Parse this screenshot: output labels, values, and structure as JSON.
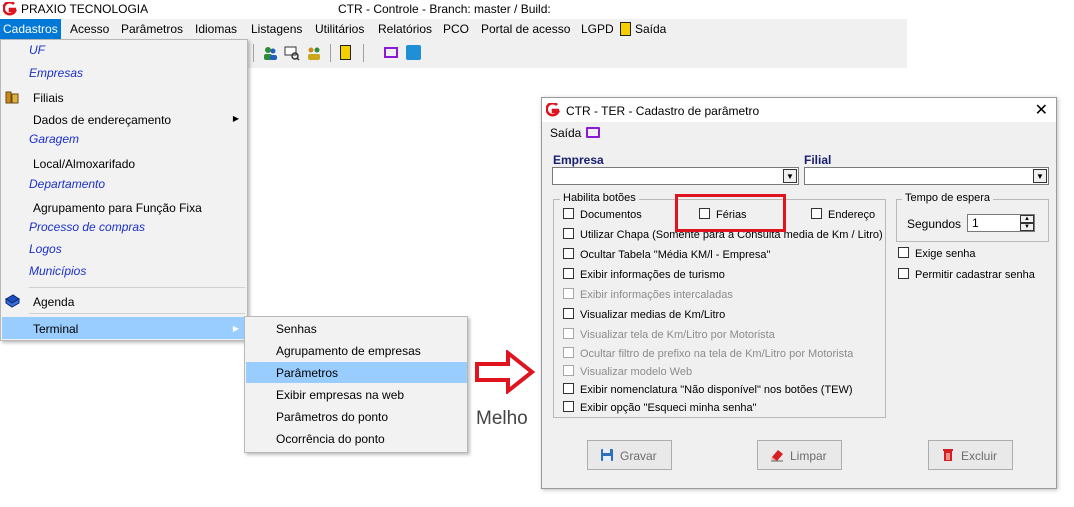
{
  "app": {
    "name": "PRAXIO TECNOLOGIA",
    "window_title": "CTR - Controle - Branch: master / Build:"
  },
  "menubar": {
    "items": [
      "Cadastros",
      "Acesso",
      "Parâmetros",
      "Idiomas",
      "Listagens",
      "Utilitários",
      "Relatórios",
      "PCO",
      "Portal de acesso",
      "LGPD"
    ],
    "saida": "Saída"
  },
  "cadastros_menu": {
    "items": [
      "UF",
      "Empresas",
      "Filiais",
      "Dados de endereçamento",
      "Garagem",
      "Local/Almoxarifado",
      "Departamento",
      "Agrupamento para Função Fixa",
      "Processo de compras",
      "Logos",
      "Municípios",
      "Agenda",
      "Terminal"
    ]
  },
  "terminal_submenu": {
    "items": [
      "Senhas",
      "Agrupamento de empresas",
      "Parâmetros",
      "Exibir empresas na web",
      "Parâmetros do ponto",
      "Ocorrência do ponto"
    ]
  },
  "background_text": "Melho",
  "dialog": {
    "title": "CTR - TER - Cadastro de parâmetro",
    "saida": "Saída",
    "empresa_label": "Empresa",
    "filial_label": "Filial",
    "habilita_title": "Habilita botões",
    "checkboxes": {
      "documentos": "Documentos",
      "ferias": "Férias",
      "endereco": "Endereço",
      "utilizar_chapa": "Utilizar Chapa (Somente para a Consulta media de Km / Litro)",
      "ocultar_tabela": "Ocultar Tabela \"Média KM/l - Empresa\"",
      "exibir_turismo": "Exibir informações de turismo",
      "exibir_intercaladas": "Exibir informações intercaladas",
      "visualizar_medias": "Visualizar medias de Km/Litro",
      "visualizar_tela": "Visualizar tela de Km/Litro por Motorista",
      "ocultar_filtro": "Ocultar filtro de prefixo na tela de Km/Litro por Motorista",
      "visualizar_modelo": "Visualizar modelo Web",
      "exibir_nomenclatura": "Exibir nomenclatura \"Não disponível\" nos botões (TEW)",
      "exibir_esqueci": "Exibir opção \"Esqueci minha senha\""
    },
    "tempo_title": "Tempo de espera",
    "segundos_label": "Segundos",
    "segundos_value": "1",
    "exige_senha": "Exige senha",
    "permitir_cadastrar": "Permitir cadastrar senha",
    "buttons": {
      "gravar": "Gravar",
      "limpar": "Limpar",
      "excluir": "Excluir"
    }
  },
  "colors": {
    "menu_active": "#0078d7",
    "menu_highlight": "#99ccff",
    "link_blue": "#1a2fc9",
    "red_annotation": "#e0141e",
    "field_label": "#1a2070"
  }
}
